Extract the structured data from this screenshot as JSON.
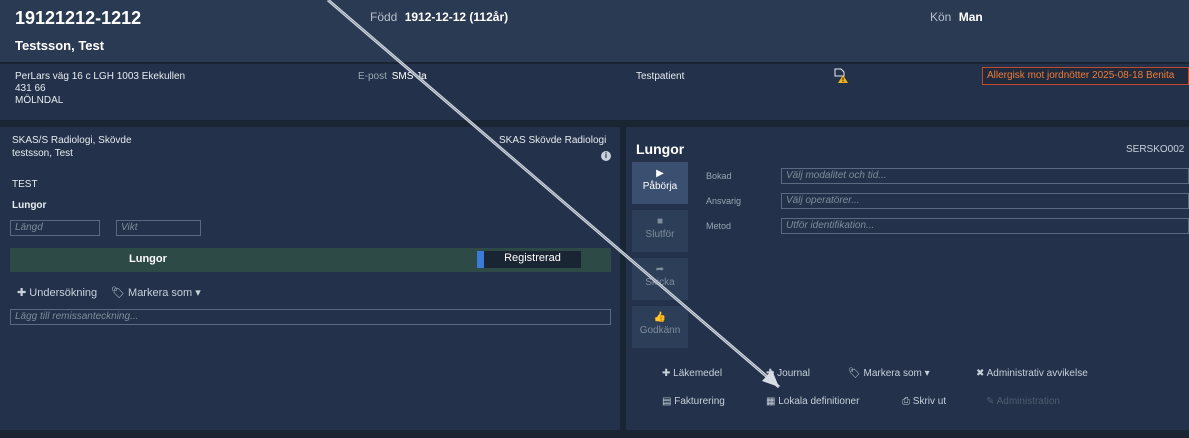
{
  "header": {
    "pnr": "19121212-1212",
    "name": "Testsson, Test",
    "fodd_label": "Född",
    "fodd_value": "1912-12-12 (112år)",
    "kon_label": "Kön",
    "kon_value": "Man"
  },
  "info": {
    "address_line1": "PerLars väg 16 c LGH 1003 Ekekullen",
    "address_line2": "431 66",
    "address_line3": "MÖLNDAL",
    "epost_label": "E-post",
    "sms_label": "SMS Ja",
    "testpatient": "Testpatient",
    "allergy": "Allergisk mot jordnötter 2025-08-18 Benita"
  },
  "left": {
    "clinic": "SKAS/S Radiologi, Skövde",
    "patient_small": "testsson, Test",
    "clinic_right": "SKAS Skövde Radiologi",
    "info_icon": "i",
    "test_label": "TEST",
    "exam_title": "Lungor",
    "langd_placeholder": "Längd",
    "vikt_placeholder": "Vikt",
    "exam_row_name": "Lungor",
    "status": "Registrerad",
    "undersokning": "Undersökning",
    "markera": "Markera som",
    "remiss_placeholder": "Lägg till remissanteckning..."
  },
  "right": {
    "title": "Lungor",
    "code": "SERSKO002",
    "side_buttons": [
      "Påbörja",
      "Slutför",
      "Skicka",
      "Godkänn"
    ],
    "field_labels": [
      "Bokad",
      "Ansvarig",
      "Metod"
    ],
    "field_placeholders": [
      "Välj modalitet och tid...",
      "Välj operatörer...",
      "Utför identifikation..."
    ],
    "bottom_row1": [
      "Läkemedel",
      "Journal",
      "Markera som",
      "Administrativ avvikelse"
    ],
    "bottom_row2": [
      "Fakturering",
      "Lokala definitioner",
      "Skriv ut",
      "Administration"
    ]
  },
  "icons": {
    "warning": "warning-document-icon",
    "plus": "plus-icon",
    "tag": "tag-icon",
    "play": "play-icon",
    "stop": "stop-icon",
    "share": "share-icon",
    "thumbs_up": "thumbs-up-icon",
    "close": "close-icon",
    "billing": "billing-icon",
    "calendar": "calendar-icon",
    "print": "print-icon",
    "edit": "edit-icon"
  },
  "colors": {
    "allergy": "#f07a3a",
    "status_accent": "#3a7ad8",
    "exam_row": "#2d4a47"
  }
}
